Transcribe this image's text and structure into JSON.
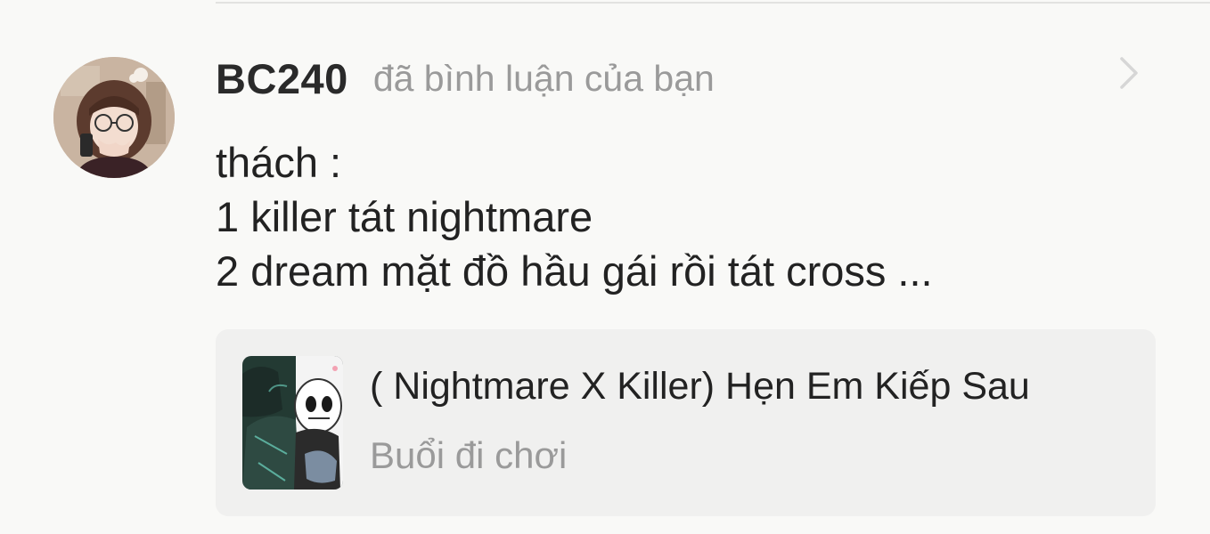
{
  "notification": {
    "username": "BC240",
    "action_text": "đã bình luận của bạn",
    "avatar_icon": "user-avatar-icon",
    "chevron_icon": "chevron-right-icon",
    "comment_lines": [
      "thách :",
      "1 killer tát nightmare",
      "2 dream mặt đồ hầu gái rồi tát cross ..."
    ]
  },
  "story_card": {
    "title": "( Nightmare X Killer) Hẹn Em Kiếp Sau",
    "chapter": "Buổi đi chơi",
    "cover_icon": "story-cover-image"
  },
  "colors": {
    "background": "#f9f9f7",
    "card_background": "#f0f0ef",
    "primary_text": "#222222",
    "secondary_text": "#9a9a9a",
    "chevron": "#d6d6d6"
  }
}
